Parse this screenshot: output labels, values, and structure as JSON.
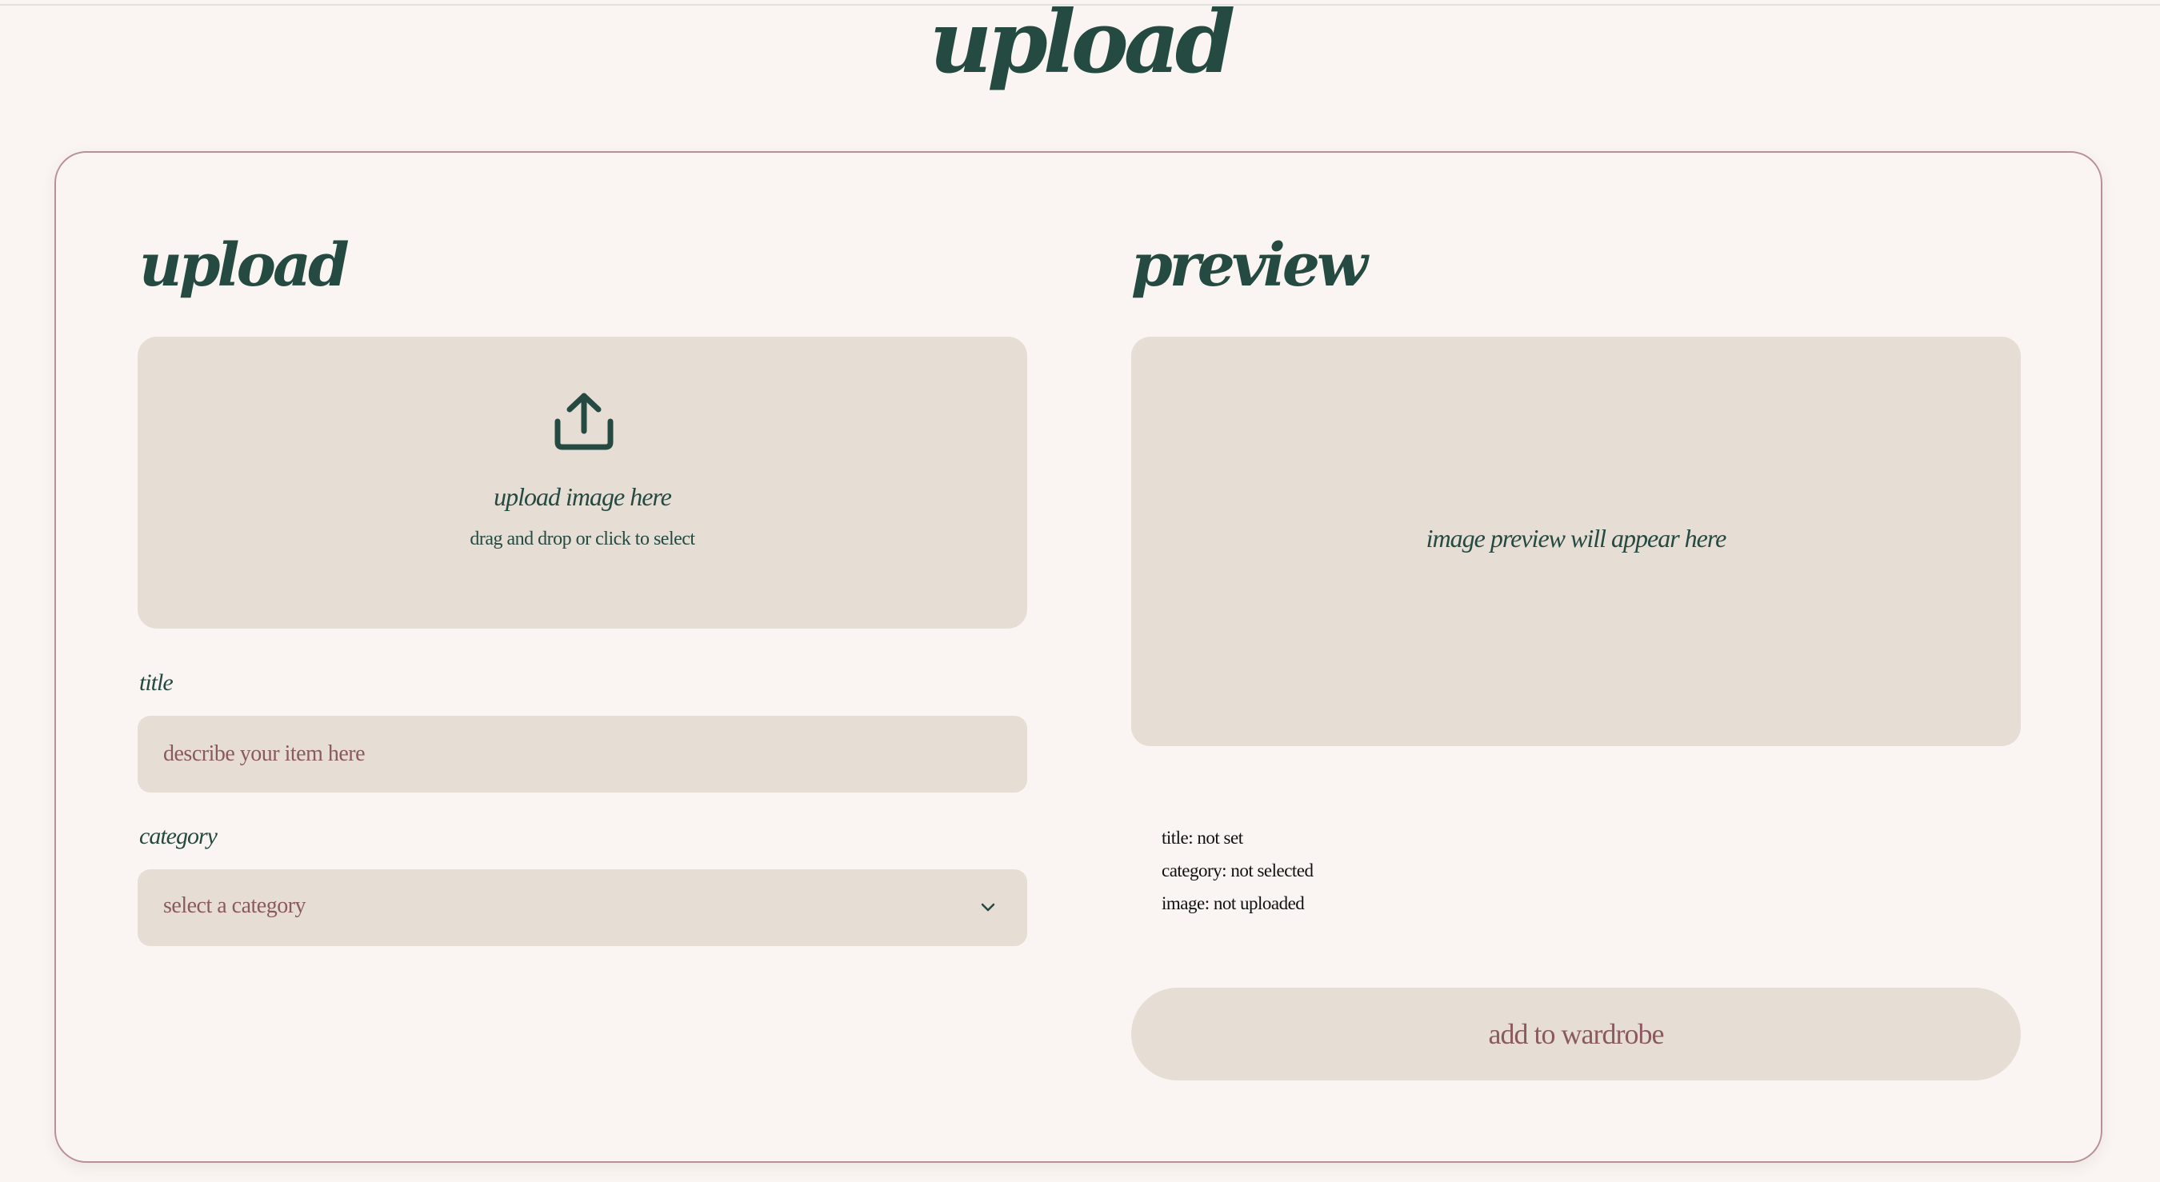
{
  "page": {
    "title": "upload"
  },
  "upload_section": {
    "title": "upload",
    "dropzone": {
      "icon": "upload-icon",
      "main_text": "upload image here",
      "sub_text": "drag and drop or click to select"
    },
    "title_field": {
      "label": "title",
      "value": "",
      "placeholder": "describe your item here"
    },
    "category_field": {
      "label": "category",
      "selected": "select a category",
      "icon": "chevron-down-icon"
    }
  },
  "preview_section": {
    "title": "preview",
    "placeholder_text": "image preview will appear here",
    "summary": {
      "title_line": "title: not set",
      "category_line": "category: not selected",
      "image_line": "image: not uploaded"
    },
    "add_button_label": "add to wardrobe"
  },
  "colors": {
    "background": "#faf5f2",
    "panel": "#e6ddd5",
    "primary_text": "#254a41",
    "accent_text": "#8a5a60",
    "card_border": "#b99097"
  }
}
